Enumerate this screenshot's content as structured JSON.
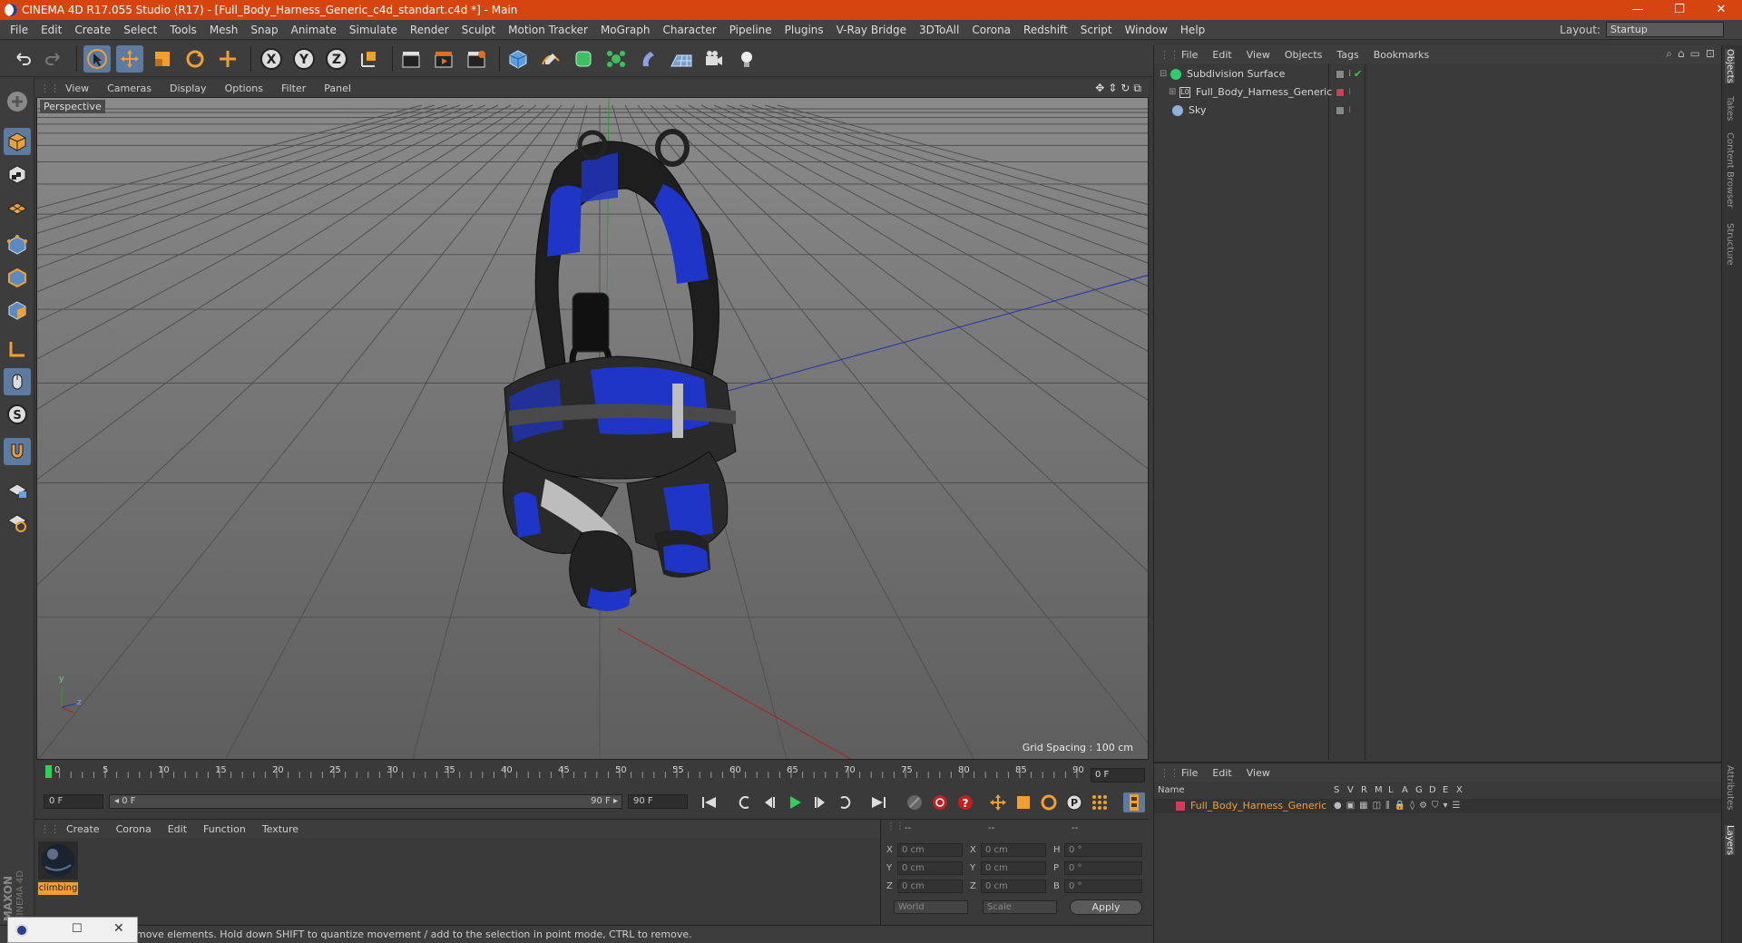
{
  "window": {
    "title": "CINEMA 4D R17.055 Studio (R17) - [Full_Body_Harness_Generic_c4d_standart.c4d *] - Main",
    "minimize": "—",
    "restore": "❐",
    "close": "✕"
  },
  "menubar": {
    "items": [
      "File",
      "Edit",
      "Create",
      "Select",
      "Tools",
      "Mesh",
      "Snap",
      "Animate",
      "Simulate",
      "Render",
      "Sculpt",
      "Motion Tracker",
      "MoGraph",
      "Character",
      "Pipeline",
      "Plugins",
      "V-Ray Bridge",
      "3DToAll",
      "Corona",
      "Redshift",
      "Script",
      "Window",
      "Help"
    ],
    "layout_label": "Layout:",
    "layout_value": "Startup"
  },
  "toolbar": {
    "axis_x": "X",
    "axis_y": "Y",
    "axis_z": "Z"
  },
  "viewport": {
    "menu": [
      "View",
      "Cameras",
      "Display",
      "Options",
      "Filter",
      "Panel"
    ],
    "name": "Perspective",
    "grid_spacing": "Grid Spacing : 100 cm",
    "axis_y": "y",
    "axis_z": "z"
  },
  "timeline": {
    "ticks": [
      "0",
      "5",
      "10",
      "15",
      "20",
      "25",
      "30",
      "35",
      "40",
      "45",
      "50",
      "55",
      "60",
      "65",
      "70",
      "75",
      "80",
      "85",
      "90"
    ],
    "current_frame": "0 F",
    "start_field": "0 F",
    "range_start": "◂ 0 F",
    "range_end": "90 F ▸",
    "end_field": "90 F"
  },
  "material_panel": {
    "menu": [
      "Create",
      "Corona",
      "Edit",
      "Function",
      "Texture"
    ],
    "material_name": "climbing"
  },
  "coordinates": {
    "headers": [
      "--",
      "--",
      "--"
    ],
    "rows": [
      {
        "l1": "X",
        "v1": "0 cm",
        "l2": "X",
        "v2": "0 cm",
        "l3": "H",
        "v3": "0 °"
      },
      {
        "l1": "Y",
        "v1": "0 cm",
        "l2": "Y",
        "v2": "0 cm",
        "l3": "P",
        "v3": "0 °"
      },
      {
        "l1": "Z",
        "v1": "0 cm",
        "l2": "Z",
        "v2": "0 cm",
        "l3": "B",
        "v3": "0 °"
      }
    ],
    "mode1": "World",
    "mode2": "Scale",
    "apply": "Apply"
  },
  "object_manager": {
    "menu": [
      "File",
      "Edit",
      "View",
      "Objects",
      "Tags",
      "Bookmarks"
    ],
    "objects": [
      {
        "name": "Subdivision Surface",
        "color": "#2ecc71"
      },
      {
        "name": "Full_Body_Harness_Generic",
        "color": "#d23c5a"
      },
      {
        "name": "Sky",
        "color": "#8fb0d8"
      }
    ]
  },
  "layer_manager": {
    "menu": [
      "File",
      "Edit",
      "View"
    ],
    "columns": [
      "Name",
      "S",
      "V",
      "R",
      "M",
      "L",
      "A",
      "G",
      "D",
      "E",
      "X"
    ],
    "layer_name": "Full_Body_Harness_Generic",
    "layer_color": "#d23c5a"
  },
  "right_tabs": [
    "Objects",
    "Takes",
    "Content Browser",
    "Structure",
    "Attributes",
    "Layers"
  ],
  "statusbar": {
    "text": "move elements. Hold down SHIFT to quantize movement / add to the selection in point mode, CTRL to remove."
  },
  "branding": {
    "maxon": "MAXON",
    "product": "CINEMA 4D"
  },
  "colors": {
    "titlebar": "#d6440f",
    "selected_tool": "#5d7aa0",
    "harness_blue": "#1f35c8"
  }
}
